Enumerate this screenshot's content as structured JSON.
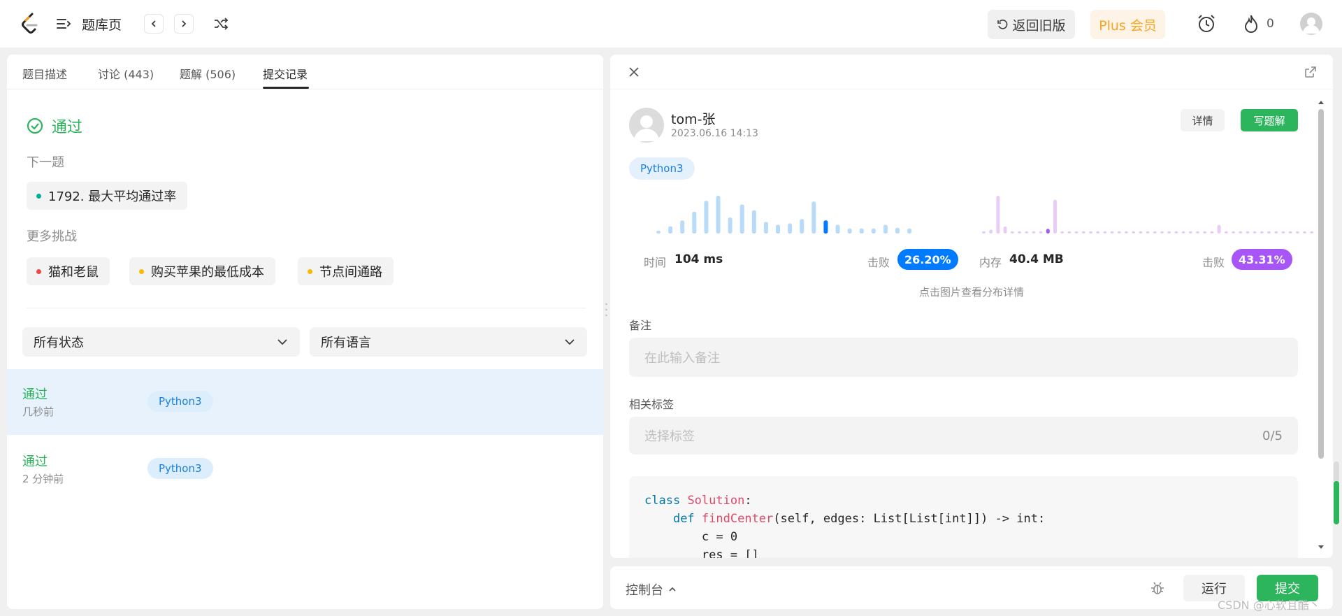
{
  "header": {
    "title": "题库页",
    "old_version": "返回旧版",
    "plus": "Plus 会员",
    "fire_count": "0"
  },
  "tabs": [
    {
      "label": "题目描述"
    },
    {
      "label": "讨论 (443)"
    },
    {
      "label": "题解 (506)"
    },
    {
      "label": "提交记录"
    }
  ],
  "result": {
    "status": "通过",
    "next_label": "下一题",
    "next_problem": "1792. 最大平均通过率",
    "more_label": "更多挑战",
    "challenges": [
      {
        "label": "猫和老鼠",
        "color": "#ef4743"
      },
      {
        "label": "购买苹果的最低成本",
        "color": "#ffb800"
      },
      {
        "label": "节点间通路",
        "color": "#ffb800"
      }
    ],
    "next_dot_color": "#00af9b"
  },
  "filters": {
    "status": "所有状态",
    "language": "所有语言"
  },
  "submissions": [
    {
      "status": "通过",
      "time": "几秒前",
      "lang": "Python3"
    },
    {
      "status": "通过",
      "time": "2 分钟前",
      "lang": "Python3"
    }
  ],
  "detail": {
    "user": "tom-张",
    "datetime": "2023.06.16 14:13",
    "detail_btn": "详情",
    "write_btn": "写题解",
    "language": "Python3",
    "runtime_label": "时间",
    "runtime": "104 ms",
    "runtime_beat_label": "击败",
    "runtime_beat": "26.20%",
    "memory_label": "内存",
    "memory": "40.4 MB",
    "memory_beat_label": "击败",
    "memory_beat": "43.31%",
    "hint": "点击图片查看分布详情",
    "note_label": "备注",
    "note_placeholder": "在此输入备注",
    "tags_label": "相关标签",
    "tags_placeholder": "选择标签",
    "tags_count": "0/5"
  },
  "code": {
    "line1_kw": "class",
    "line1_name": "Solution",
    "line2_kw": "def",
    "line2_fn": "findCenter",
    "line2_params": "(self, edges: List[List[int]]) -> int:",
    "line3": "c = 0",
    "line4": "res = []"
  },
  "bottom": {
    "console": "控制台",
    "run": "运行",
    "submit": "提交"
  },
  "watermark": "CSDN @心软且酷丶",
  "colors": {
    "accent_green": "#2db55d",
    "accent_blue": "#007aff",
    "accent_purple": "#a855f7",
    "plus_orange": "#f5a623"
  },
  "chart_data": [
    {
      "type": "bar",
      "name": "runtime-distribution",
      "values": [
        4,
        10,
        18,
        30,
        45,
        52,
        22,
        40,
        32,
        16,
        12,
        14,
        20,
        44,
        18,
        12,
        7,
        7,
        7,
        12,
        8,
        7
      ],
      "highlight_index": 14
    },
    {
      "type": "bar",
      "name": "memory-distribution",
      "values": [
        3,
        5,
        48,
        9,
        3,
        3,
        3,
        3,
        3,
        6,
        43,
        3,
        3,
        3,
        3,
        3,
        3,
        3,
        3,
        3,
        3,
        3,
        3,
        3,
        3,
        3,
        3,
        3,
        3,
        3,
        3,
        3,
        3,
        11,
        3,
        3,
        3,
        3,
        3,
        3,
        3,
        3,
        3,
        3,
        3,
        3,
        3
      ],
      "highlight_index": 9
    }
  ]
}
